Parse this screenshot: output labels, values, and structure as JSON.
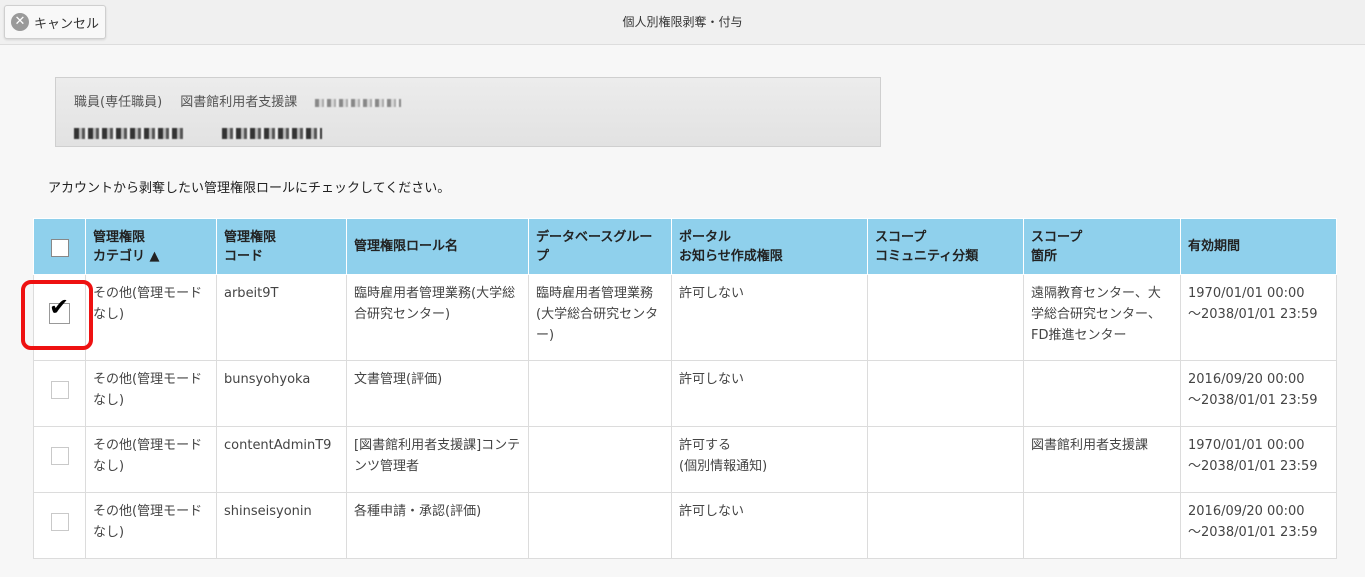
{
  "toolbar": {
    "cancel_label": "キャンセル",
    "title": "個人別権限剥奪・付与"
  },
  "user": {
    "line1_a": "職員(専任職員)",
    "line1_b": "図書館利用者支援課"
  },
  "instruction": "アカウントから剥奪したい管理権限ロールにチェックしてください。",
  "table": {
    "headers": {
      "category_l1": "管理権限",
      "category_l2": "カテゴリ ▲",
      "code_l1": "管理権限",
      "code_l2": "コード",
      "role_name": "管理権限ロール名",
      "db_group": "データベースグループ",
      "portal_l1": "ポータル",
      "portal_l2": "お知らせ作成権限",
      "scope_comm_l1": "スコープ",
      "scope_comm_l2": "コミュニティ分類",
      "scope_place_l1": "スコープ",
      "scope_place_l2": "箇所",
      "period": "有効期間"
    },
    "rows": [
      {
        "checked": true,
        "category": "その他(管理モードなし)",
        "code": "arbeit9T",
        "role_name": "臨時雇用者管理業務(大学総合研究センター)",
        "db_group": "臨時雇用者管理業務(大学総合研究センター)",
        "portal_l1": "許可しない",
        "portal_l2": "",
        "scope_comm": "",
        "scope_place": "遠隔教育センター、大学総合研究センター、FD推進センター",
        "period_l1": "1970/01/01 00:00",
        "period_l2": "～2038/01/01 23:59"
      },
      {
        "checked": false,
        "category": "その他(管理モードなし)",
        "code": "bunsyohyoka",
        "role_name": "文書管理(評価)",
        "db_group": "",
        "portal_l1": "許可しない",
        "portal_l2": "",
        "scope_comm": "",
        "scope_place": "",
        "period_l1": "2016/09/20 00:00",
        "period_l2": "～2038/01/01 23:59"
      },
      {
        "checked": false,
        "category": "その他(管理モードなし)",
        "code": "contentAdminT9",
        "role_name": "[図書館利用者支援課]コンテンツ管理者",
        "db_group": "",
        "portal_l1": "許可する",
        "portal_l2": "(個別情報通知)",
        "scope_comm": "",
        "scope_place": "図書館利用者支援課",
        "period_l1": "1970/01/01 00:00",
        "period_l2": "～2038/01/01 23:59"
      },
      {
        "checked": false,
        "category": "その他(管理モードなし)",
        "code": "shinseisyonin",
        "role_name": "各種申請・承認(評価)",
        "db_group": "",
        "portal_l1": "許可しない",
        "portal_l2": "",
        "scope_comm": "",
        "scope_place": "",
        "period_l1": "2016/09/20 00:00",
        "period_l2": "～2038/01/01 23:59"
      }
    ]
  },
  "colors": {
    "header_bg": "#8fd0ec",
    "highlight": "#e11111"
  }
}
